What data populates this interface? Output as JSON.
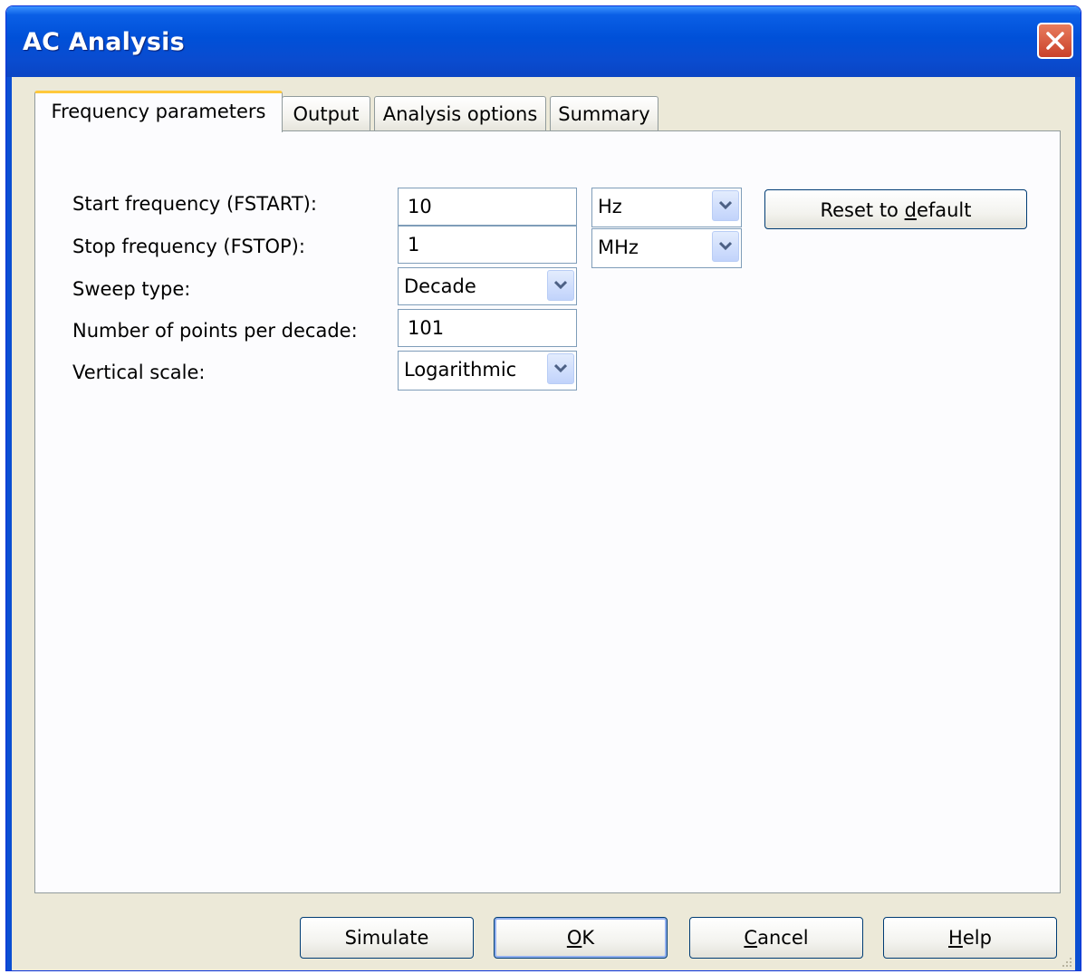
{
  "window": {
    "title": "AC Analysis"
  },
  "tabs": [
    {
      "label": "Frequency parameters",
      "active": true
    },
    {
      "label": "Output",
      "active": false
    },
    {
      "label": "Analysis options",
      "active": false
    },
    {
      "label": "Summary",
      "active": false
    }
  ],
  "form": {
    "start_frequency": {
      "label": "Start frequency (FSTART):",
      "value": "10",
      "unit": "Hz"
    },
    "stop_frequency": {
      "label": "Stop frequency (FSTOP):",
      "value": "1",
      "unit": "MHz"
    },
    "sweep_type": {
      "label": "Sweep type:",
      "value": "Decade"
    },
    "points_per_decade": {
      "label": "Number of points per decade:",
      "value": "101"
    },
    "vertical_scale": {
      "label": "Vertical scale:",
      "value": "Logarithmic"
    },
    "reset_button": {
      "pre": "Reset to ",
      "mnemonic": "d",
      "post": "efault"
    }
  },
  "buttons": {
    "simulate": {
      "label": "Simulate"
    },
    "ok": {
      "mnemonic": "O",
      "post": "K"
    },
    "cancel": {
      "mnemonic": "C",
      "post": "ancel"
    },
    "help": {
      "mnemonic": "H",
      "post": "elp"
    }
  },
  "icons": {
    "close": "close-icon",
    "dropdown": "chevron-down-icon"
  },
  "colors": {
    "titlebar": "#0050d8",
    "dialog_bg": "#ece9d8",
    "active_tab_accent": "#ffc83c"
  }
}
